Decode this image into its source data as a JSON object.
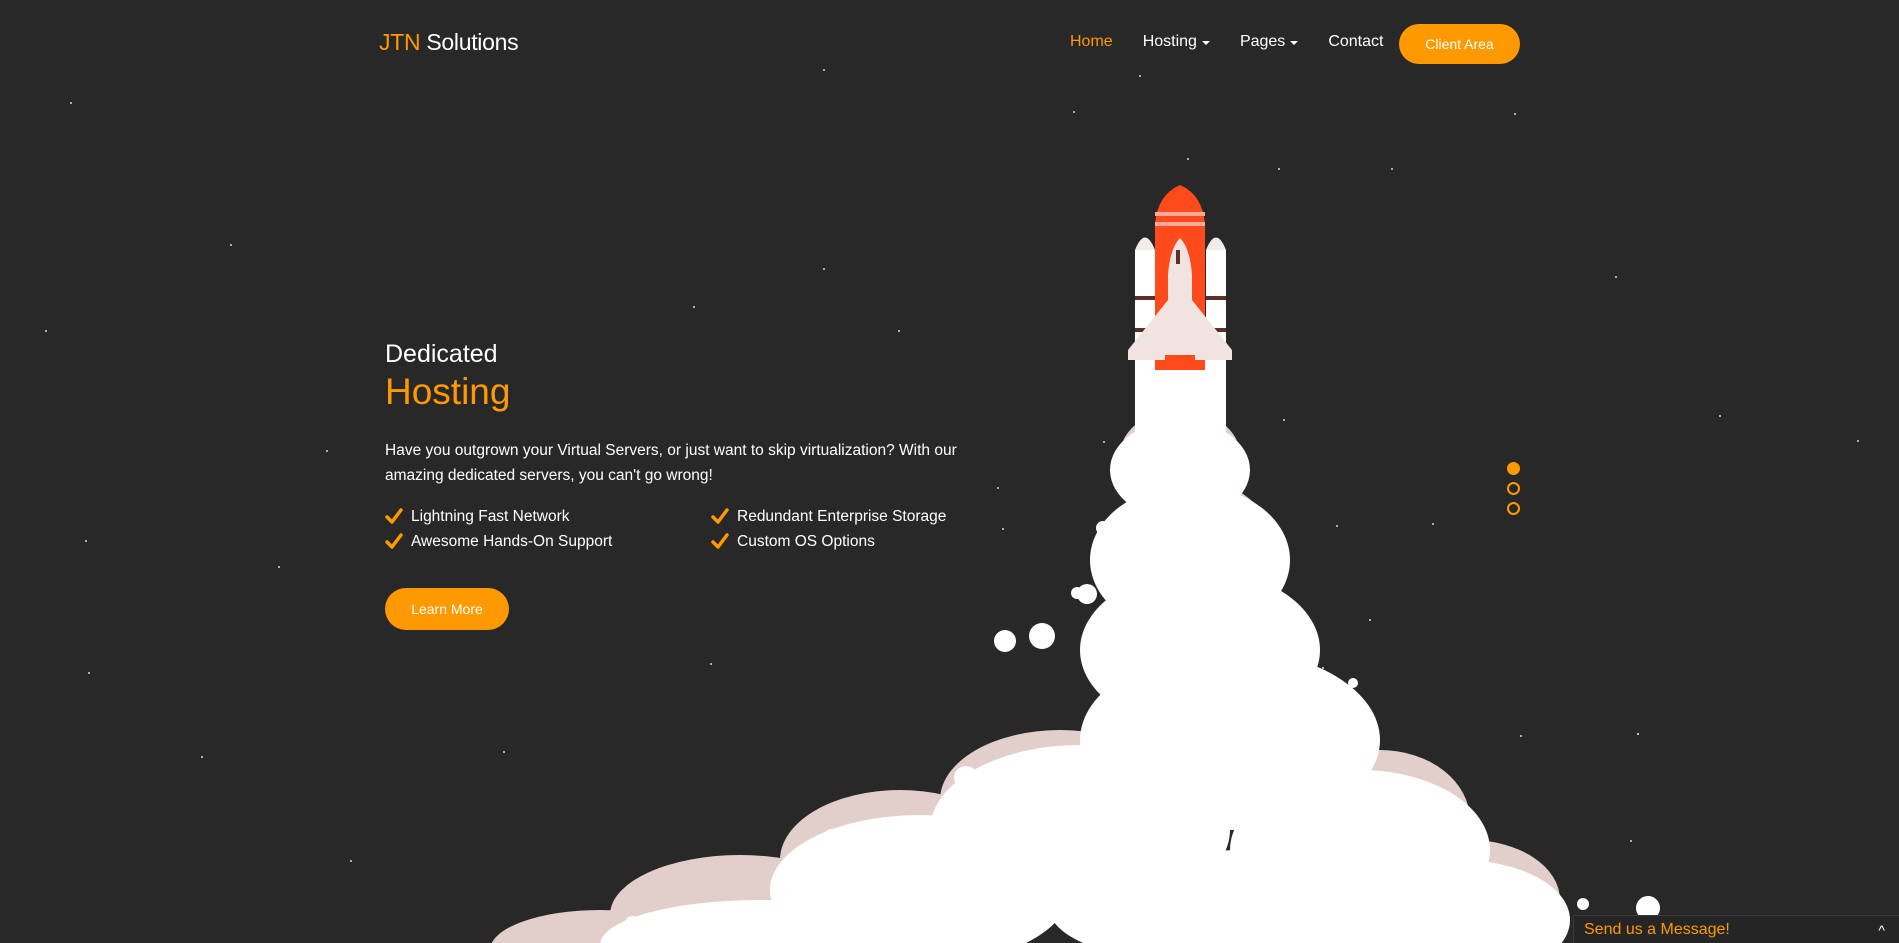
{
  "brand": {
    "part1": "JTN",
    "part2": " Solutions"
  },
  "nav": {
    "items": [
      {
        "label": "Home",
        "active": true,
        "dropdown": false
      },
      {
        "label": "Hosting",
        "active": false,
        "dropdown": true
      },
      {
        "label": "Pages",
        "active": false,
        "dropdown": true
      },
      {
        "label": "Contact",
        "active": false,
        "dropdown": false
      }
    ],
    "client_area": "Client Area"
  },
  "hero": {
    "title_line1": "Dedicated",
    "title_line2": "Hosting",
    "description": "Have you outgrown your Virtual Servers, or just want to skip virtualization? With our amazing dedicated servers, you can't go wrong!",
    "features": [
      "Lightning Fast Network",
      "Redundant Enterprise Storage",
      "Awesome Hands-On Support",
      "Custom OS Options"
    ],
    "cta": "Learn More"
  },
  "slider": {
    "count": 3,
    "active_index": 0
  },
  "chat": {
    "label": "Send us a Message!",
    "chevron": "^"
  },
  "colors": {
    "accent": "#ff9900",
    "background": "#282828",
    "text": "#ffffff",
    "rocket_red": "#ff4a1c",
    "smoke": "#ffffff",
    "smoke_shadow": "#e2cfcb"
  },
  "icons": [
    "check-icon",
    "caret-down-icon",
    "chevron-up-icon",
    "rocket-illustration"
  ]
}
